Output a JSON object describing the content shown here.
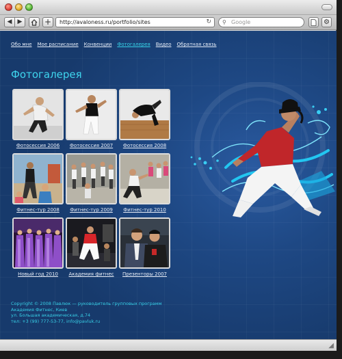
{
  "browser": {
    "url": "http://avaloness.ru/portfolio/sites",
    "search_placeholder": "Google",
    "reload_icon": "reload-icon",
    "search_icon": "search-icon"
  },
  "nav": {
    "items": [
      {
        "label": "Обо мне",
        "active": false
      },
      {
        "label": "Мое расписание",
        "active": false
      },
      {
        "label": "Конвенции",
        "active": false
      },
      {
        "label": "Фотогалерея",
        "active": true
      },
      {
        "label": "Видео",
        "active": false
      },
      {
        "label": "Обратная связь",
        "active": false
      }
    ]
  },
  "page": {
    "title": "Фотогалерея",
    "colors": {
      "background": "#1e4884",
      "accent": "#37d3e8",
      "hero_shirt": "#c0262a"
    }
  },
  "gallery": [
    {
      "caption": "Фотосессия 2006",
      "scene": "studio-white"
    },
    {
      "caption": "Фотосессия 2007",
      "scene": "studio-white"
    },
    {
      "caption": "Фотосессия 2008",
      "scene": "studio-wood"
    },
    {
      "caption": "Фитнес-тур 2008",
      "scene": "outdoor"
    },
    {
      "caption": "Фитнес-тур 2009",
      "scene": "crowd"
    },
    {
      "caption": "Фитнес-тур 2010",
      "scene": "crowd"
    },
    {
      "caption": "Новый год 2010",
      "scene": "stage-purple"
    },
    {
      "caption": "Академия фитнес",
      "scene": "dark-hall"
    },
    {
      "caption": "Презенторы 2007",
      "scene": "portrait-duo"
    }
  ],
  "footer": {
    "lines": [
      "Copyright © 2008 Павлюк — руководитель групповых программ",
      "Академия Фитнес, Киев",
      "ул. Большая академическая, д.74",
      "тел: +3 (99) 777-53-77, info@pavluk.ru"
    ]
  }
}
